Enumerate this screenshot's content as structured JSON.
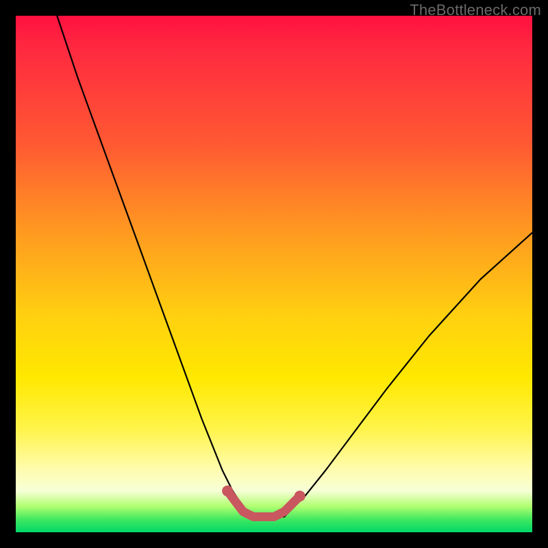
{
  "watermark": "TheBottleneck.com",
  "colors": {
    "frame": "#000000",
    "gradient_top": "#ff1040",
    "gradient_mid1": "#ff9a20",
    "gradient_mid2": "#ffe800",
    "gradient_bottom": "#00d868",
    "curve": "#000000",
    "accent": "#c9575f",
    "watermark_text": "#6a6a6a"
  },
  "chart_data": {
    "type": "line",
    "title": "",
    "xlabel": "",
    "ylabel": "",
    "xlim": [
      0,
      100
    ],
    "ylim": [
      0,
      100
    ],
    "grid": false,
    "legend": false,
    "series": [
      {
        "name": "bottleneck-curve",
        "x": [
          8,
          12,
          16,
          20,
          24,
          28,
          32,
          36,
          38,
          40,
          42,
          44,
          46,
          48,
          52,
          56,
          60,
          66,
          72,
          80,
          90,
          100
        ],
        "y": [
          100,
          88,
          77,
          66,
          55,
          44,
          33,
          22,
          17,
          12,
          8,
          5,
          3,
          3,
          3,
          7,
          12,
          20,
          28,
          38,
          49,
          58
        ],
        "note": "y is percent height from bottom (0) to top (100); curve dips to ~3 near x≈46–50 then rises"
      },
      {
        "name": "optimal-region-highlight",
        "x": [
          41,
          44,
          46,
          48,
          50,
          52,
          55
        ],
        "y": [
          8,
          4,
          3,
          3,
          3,
          4,
          7
        ],
        "note": "pink/rose thick overlay marking the flat minimum of the curve"
      }
    ],
    "markers": [
      {
        "name": "accent-start-dot",
        "x": 41,
        "y": 8
      },
      {
        "name": "accent-end-dot",
        "x": 55,
        "y": 7
      }
    ]
  }
}
